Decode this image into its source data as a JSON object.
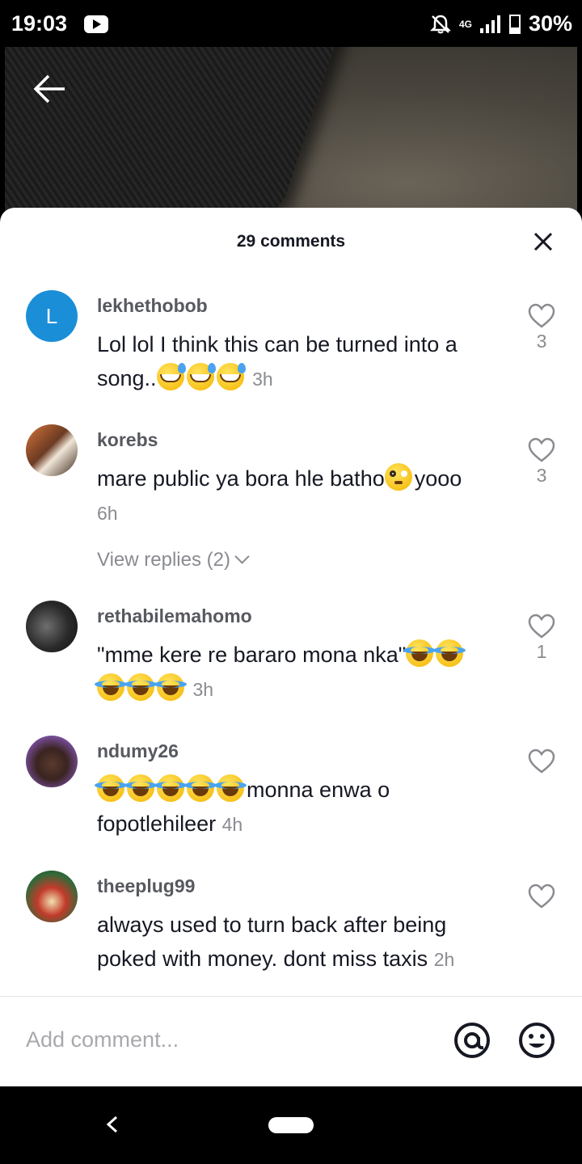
{
  "status_bar": {
    "time": "19:03",
    "network": "4G",
    "battery": "30%"
  },
  "sheet": {
    "title": "29 comments",
    "comments": [
      {
        "username": "lekhethobob",
        "avatar_letter": "L",
        "text": "Lol lol I think this can be turned into a song..",
        "emojis": [
          "sweat",
          "sweat",
          "sweat"
        ],
        "time": "3h",
        "likes": "3"
      },
      {
        "username": "korebs",
        "text_before": "mare public ya bora hle batho",
        "emojis": [
          "flush"
        ],
        "text_after": "yooo",
        "time": "6h",
        "likes": "3",
        "view_replies": "View replies (2)"
      },
      {
        "username": "rethabilemahomo",
        "text": "\"mme kere re bararo mona nka\"",
        "emojis": [
          "tears",
          "tears",
          "tears",
          "tears",
          "tears"
        ],
        "time": "3h",
        "likes": "1"
      },
      {
        "username": "ndumy26",
        "emojis": [
          "tears",
          "tears",
          "tears",
          "tears",
          "tears"
        ],
        "text": "monna enwa o fopotlehileer",
        "time": "4h",
        "likes": ""
      },
      {
        "username": "theeplug99",
        "text": "always used to turn back after being poked with money. dont miss taxis",
        "time": "2h",
        "likes": ""
      }
    ],
    "input_placeholder": "Add comment...",
    "icons": {
      "close": "close-icon",
      "like": "heart-outline-icon",
      "mention": "at-icon",
      "emoji": "smiley-icon",
      "back": "back-arrow-icon"
    }
  },
  "colors": {
    "avatar_L": "#1a8fd8",
    "primary_text": "#161823",
    "secondary_text": "#8a8b91"
  }
}
